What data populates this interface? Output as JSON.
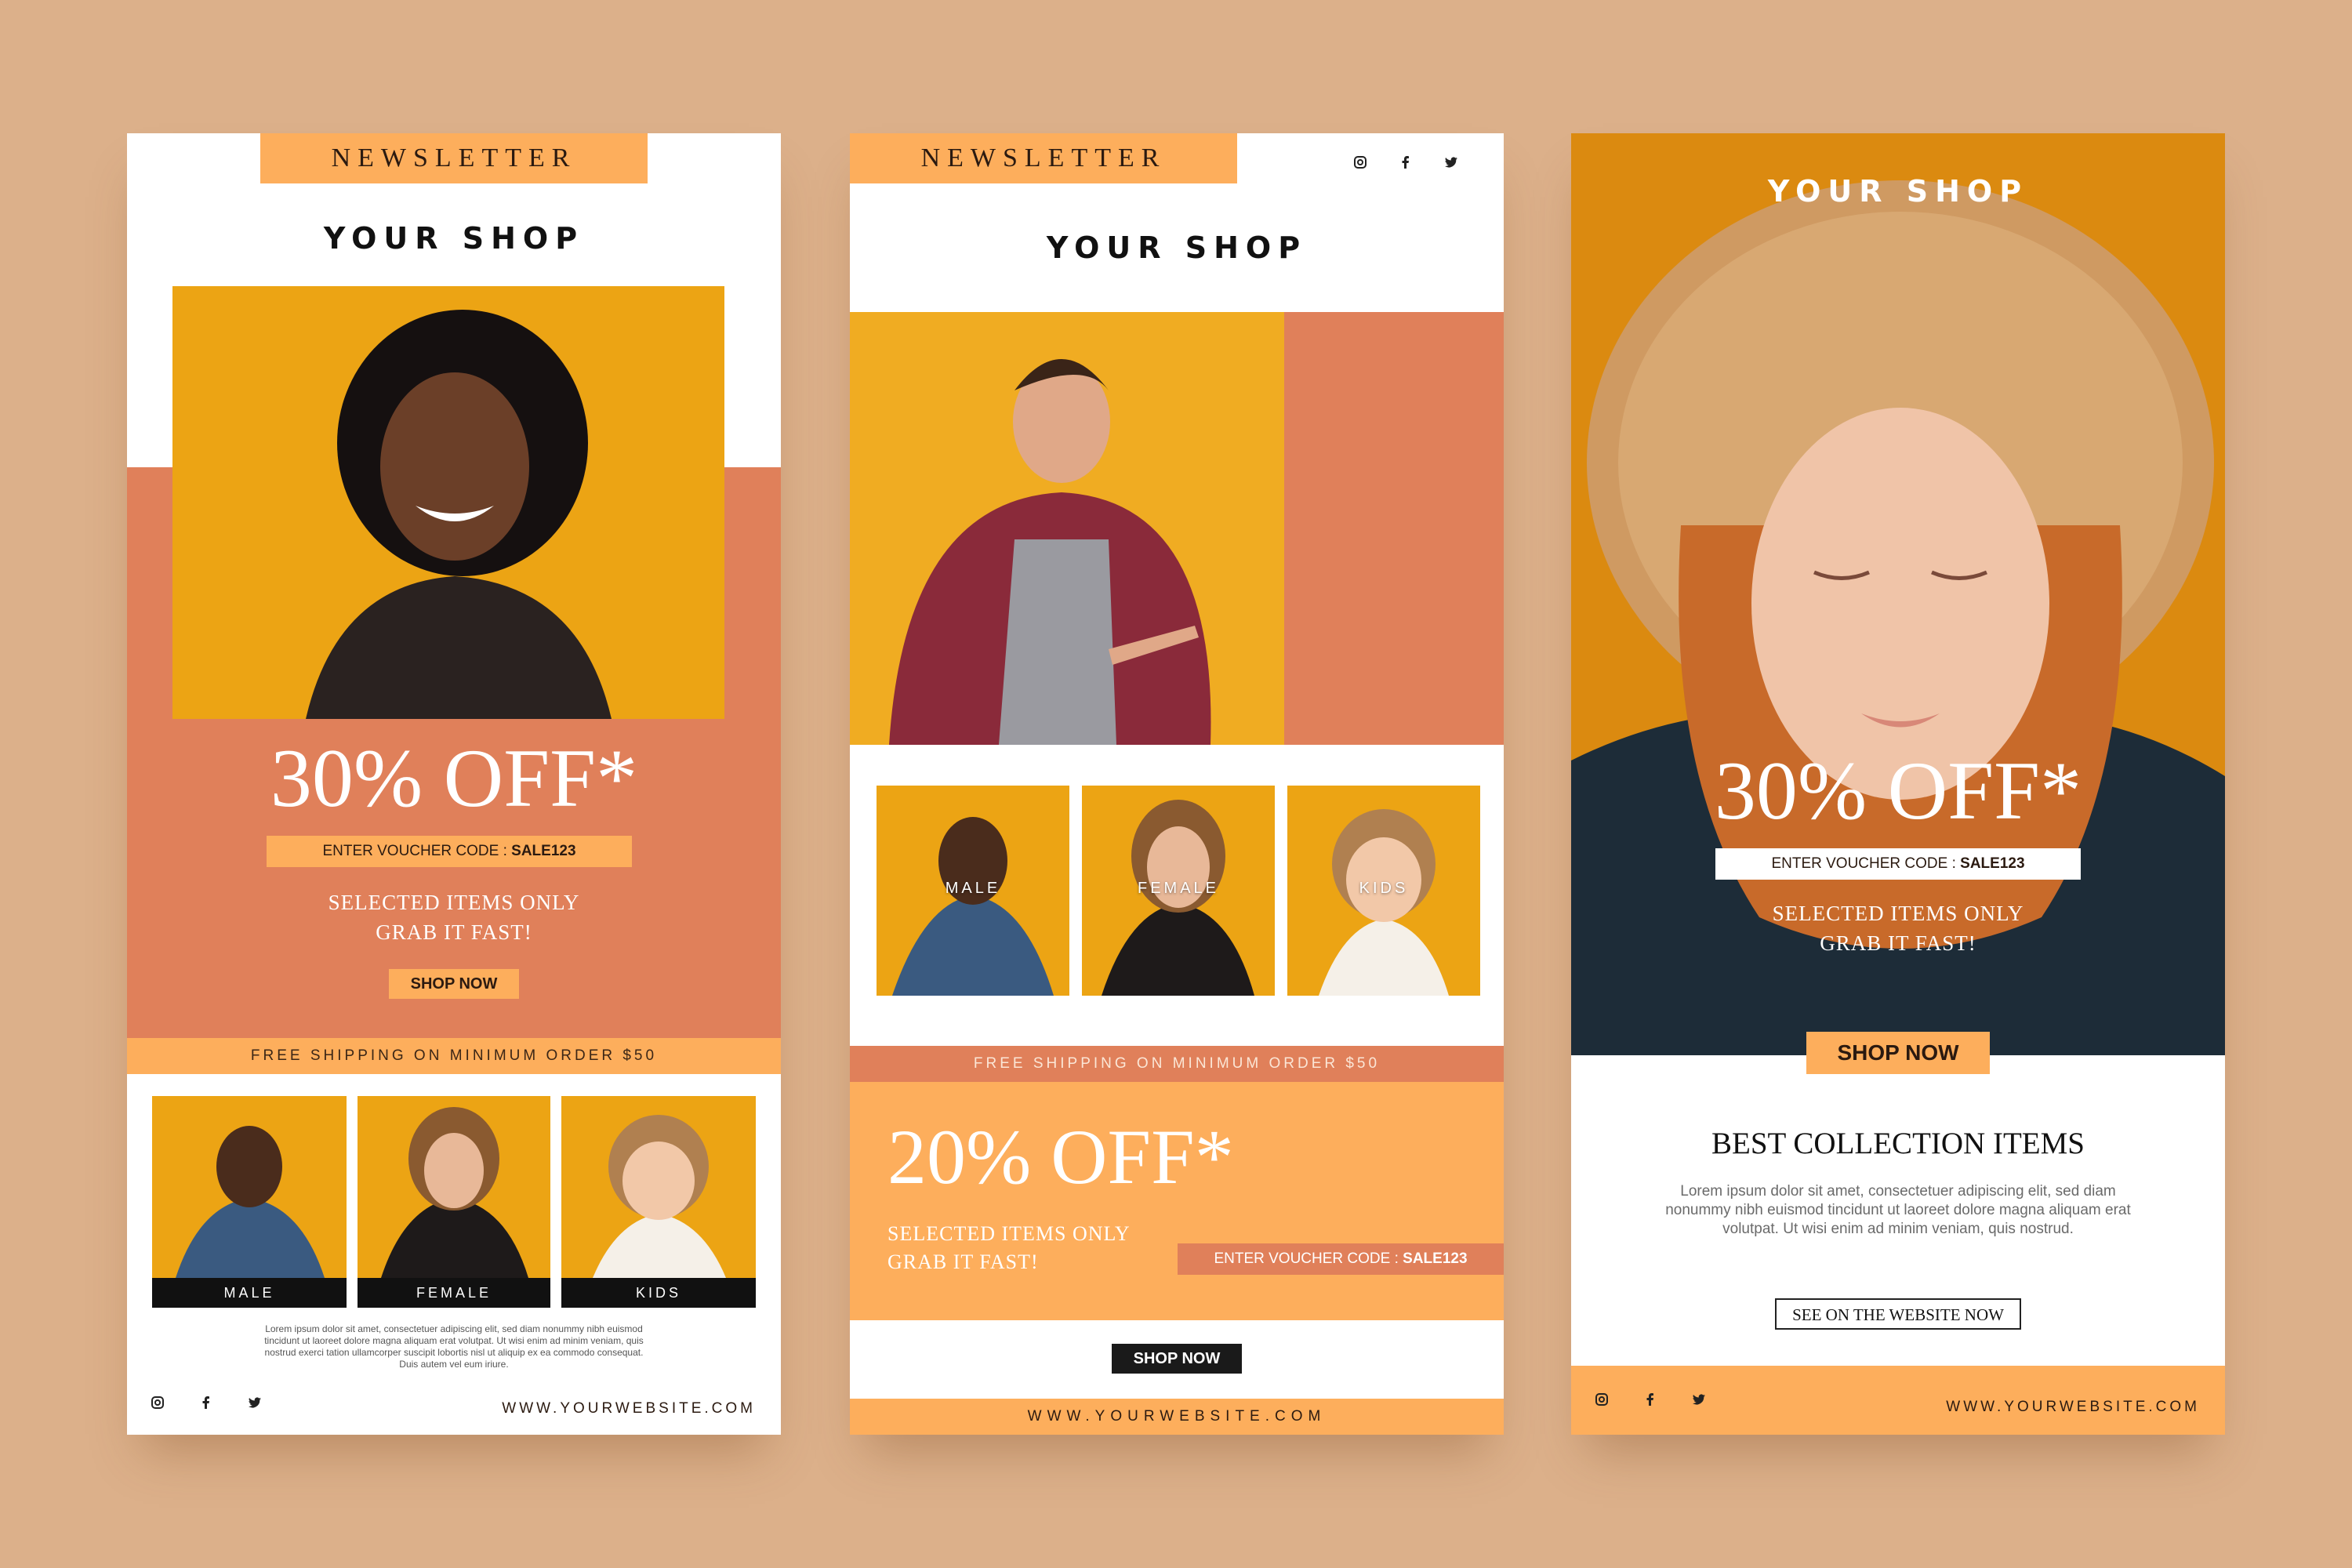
{
  "colors": {
    "background": "#dcb08a",
    "light_orange": "#fdae5c",
    "coral": "#e0805a",
    "mustard": "#f0a816",
    "deep_orange": "#db8a10",
    "dark": "#111111"
  },
  "card1": {
    "newsletter": "NEWSLETTER",
    "shop_title": "YOUR SHOP",
    "discount": "30% OFF*",
    "voucher_label": "ENTER VOUCHER CODE : ",
    "voucher_code": "SALE123",
    "selected_line1": "SELECTED ITEMS ONLY",
    "selected_line2": "GRAB IT FAST!",
    "shop_now": "SHOP NOW",
    "free_shipping": "FREE SHIPPING ON MINIMUM ORDER $50",
    "categories": [
      "MALE",
      "FEMALE",
      "KIDS"
    ],
    "lorem": "Lorem ipsum dolor sit amet, consectetuer adipiscing elit, sed diam nonummy nibh euismod tincidunt ut laoreet dolore magna aliquam erat volutpat. Ut wisi enim ad minim veniam, quis nostrud exerci tation ullamcorper suscipit lobortis nisl ut aliquip ex ea commodo consequat. Duis autem vel eum iriure.",
    "website": "WWW.YOURWEBSITE.COM",
    "social_icons": [
      "instagram-icon",
      "facebook-icon",
      "twitter-icon"
    ]
  },
  "card2": {
    "newsletter": "NEWSLETTER",
    "shop_title": "YOUR SHOP",
    "categories": [
      "MALE",
      "FEMALE",
      "KIDS"
    ],
    "free_shipping": "FREE SHIPPING ON MINIMUM ORDER $50",
    "discount": "20% OFF*",
    "selected_line1": "SELECTED ITEMS ONLY",
    "selected_line2": "GRAB IT FAST!",
    "voucher_label": "ENTER VOUCHER CODE : ",
    "voucher_code": "SALE123",
    "shop_now": "SHOP NOW",
    "website": "WWW.YOURWEBSITE.COM",
    "social_icons": [
      "instagram-icon",
      "facebook-icon",
      "twitter-icon"
    ]
  },
  "card3": {
    "shop_title": "YOUR SHOP",
    "discount": "30% OFF*",
    "voucher_label": "ENTER VOUCHER CODE : ",
    "voucher_code": "SALE123",
    "selected_line1": "SELECTED ITEMS ONLY",
    "selected_line2": "GRAB IT FAST!",
    "shop_now": "SHOP NOW",
    "collection_title": "BEST COLLECTION ITEMS",
    "lorem": "Lorem ipsum dolor sit amet, consectetuer adipiscing elit, sed diam nonummy nibh euismod tincidunt ut laoreet dolore magna aliquam erat volutpat. Ut wisi enim ad minim veniam, quis nostrud.",
    "see_website": "SEE ON THE WEBSITE NOW",
    "website": "WWW.YOURWEBSITE.COM",
    "social_icons": [
      "instagram-icon",
      "facebook-icon",
      "twitter-icon"
    ]
  }
}
